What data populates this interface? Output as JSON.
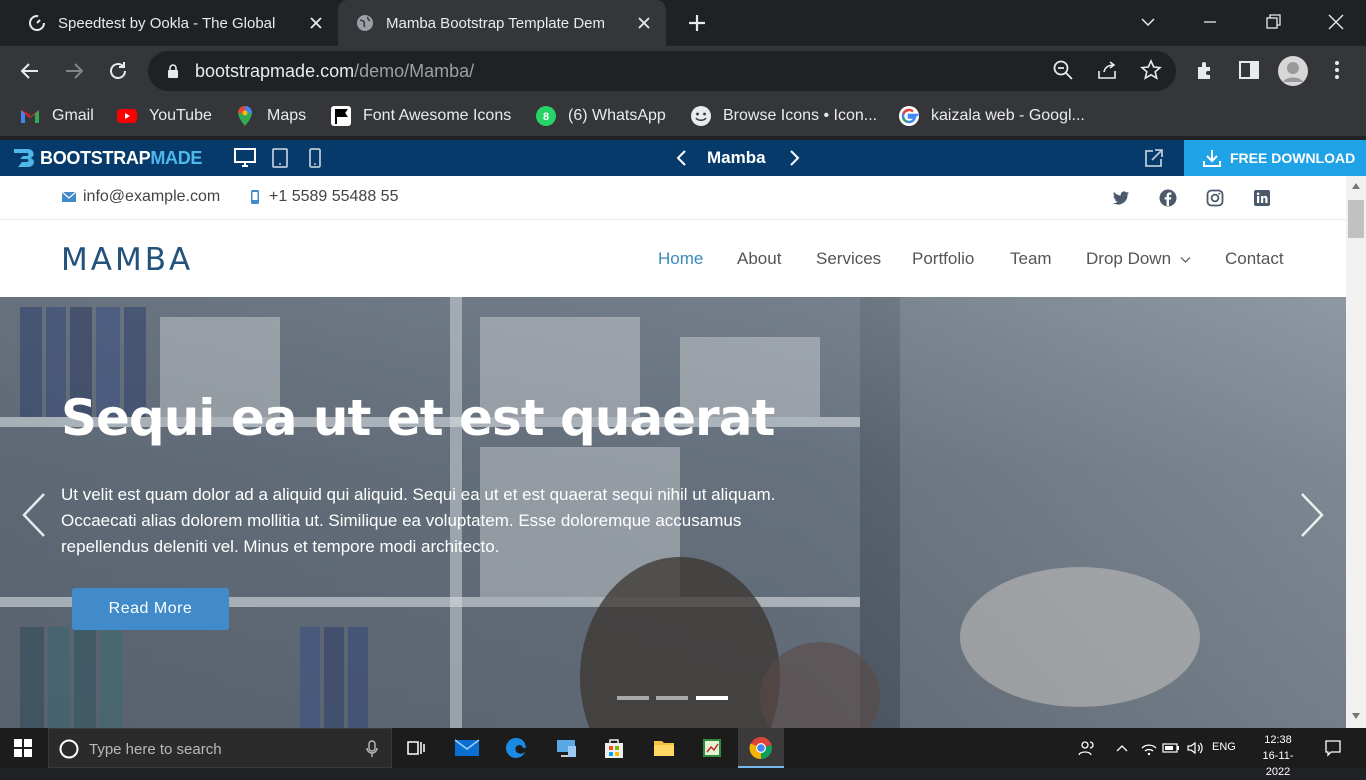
{
  "browser": {
    "tabs": [
      {
        "title": "Speedtest by Ookla - The Global"
      },
      {
        "title": "Mamba Bootstrap Template Dem"
      }
    ],
    "url_host": "bootstrapmade.com",
    "url_path": "/demo/Mamba/"
  },
  "bookmarks": [
    {
      "label": "Gmail"
    },
    {
      "label": "YouTube"
    },
    {
      "label": "Maps"
    },
    {
      "label": "Font Awesome Icons"
    },
    {
      "label": "(6) WhatsApp"
    },
    {
      "label": "Browse Icons • Icon..."
    },
    {
      "label": "kaizala web - Googl..."
    }
  ],
  "demo_bar": {
    "logo_a": "BOOTSTRAP",
    "logo_b": "MADE",
    "template_name": "Mamba",
    "download_label": "FREE DOWNLOAD"
  },
  "site": {
    "email": "info@example.com",
    "phone": "+1 5589 55488 55",
    "logo": "MAMBA",
    "nav": [
      "Home",
      "About",
      "Services",
      "Portfolio",
      "Team",
      "Drop Down",
      "Contact"
    ],
    "hero": {
      "title": "Sequi ea ut et est quaerat",
      "text": "Ut velit est quam dolor ad a aliquid qui aliquid. Sequi ea ut et est quaerat sequi nihil ut aliquam. Occaecati alias dolorem mollitia ut. Similique ea voluptatem. Esse doloremque accusamus repellendus deleniti vel. Minus et tempore modi architecto.",
      "button": "Read More",
      "slide_count": 3,
      "active_slide": 3
    }
  },
  "taskbar": {
    "search_placeholder": "Type here to search",
    "language": "ENG",
    "time": "12:38",
    "date": "16-11-2022"
  },
  "colors": {
    "accent": "#428bca",
    "demo_bar": "#063a6b",
    "download": "#1fa3e6"
  }
}
